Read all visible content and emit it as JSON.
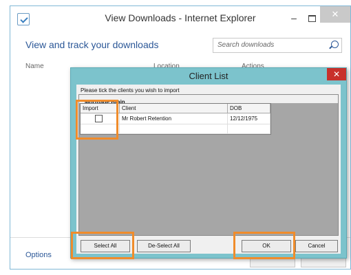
{
  "ie": {
    "title": "View Downloads - Internet Explorer",
    "minimize_glyph": "‒",
    "close_glyph": "✕",
    "heading": "View and track your downloads",
    "search_placeholder": "Search downloads",
    "columns": {
      "name": "Name",
      "location": "Location",
      "actions": "Actions"
    },
    "options_link": "Options",
    "icons": [
      "downloads-icon",
      "search-icon"
    ]
  },
  "dialog": {
    "title": "Client List",
    "close_glyph": "✕",
    "instruction": "Please tick the clients you wish to import",
    "group_label": "Mortgage Brain",
    "grid": {
      "headers": [
        "Import",
        "Client",
        "DOB"
      ],
      "rows": [
        {
          "import": false,
          "client": "Mr Robert Retention",
          "dob": "12/12/1975"
        }
      ]
    },
    "buttons": {
      "select_all": "Select All",
      "deselect_all": "De-Select All",
      "ok": "OK",
      "cancel": "Cancel"
    }
  },
  "colors": {
    "dialog_frame": "#7cc3cc",
    "dialog_close": "#c8302b",
    "highlight": "#f08c2b",
    "ie_accent": "#2b5797"
  }
}
